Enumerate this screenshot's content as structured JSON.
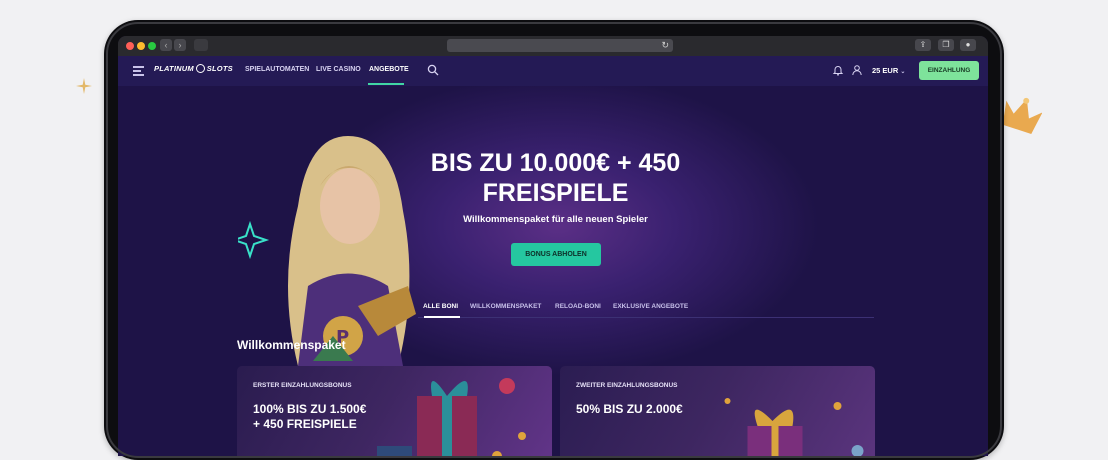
{
  "browser": {
    "nav_back": "‹",
    "nav_forward": "›",
    "reload_icon": "↻"
  },
  "site": {
    "logo_text_left": "PLATINUM",
    "logo_text_right": "SLOTS",
    "nav": [
      "SPIELAUTOMATEN",
      "LIVE CASINO",
      "ANGEBOTE"
    ],
    "active_nav": "ANGEBOTE",
    "balance": "25 EUR",
    "deposit_button": "EINZAHLUNG"
  },
  "hero": {
    "title_line1": "BIS ZU 10.000€ + 450",
    "title_line2": "FREISPIELE",
    "subtitle": "Willkommenspaket für alle neuen Spieler",
    "cta": "BONUS ABHOLEN"
  },
  "tabs": [
    "ALLE BONI",
    "WILLKOMMENSPAKET",
    "RELOAD-BONI",
    "EXKLUSIVE ANGEBOTE"
  ],
  "section_title": "Willkommenspaket",
  "cards": [
    {
      "label": "ERSTER EINZAHLUNGSBONUS",
      "offer": "100% BIS ZU 1.500€\n+ 450 FREISPIELE"
    },
    {
      "label": "ZWEITER EINZAHLUNGSBONUS",
      "offer": "50% BIS ZU 2.000€"
    }
  ],
  "colors": {
    "accent_green": "#7ee39b",
    "cta_teal": "#25c7a0",
    "page_bg": "#1c1244",
    "nav_bg": "#241a55"
  },
  "icons": [
    "sparkle-icon",
    "crown-icon",
    "menu-icon",
    "search-icon",
    "bell-icon",
    "user-icon",
    "chevron-down-icon",
    "share-icon",
    "tabs-icon",
    "download-icon"
  ]
}
